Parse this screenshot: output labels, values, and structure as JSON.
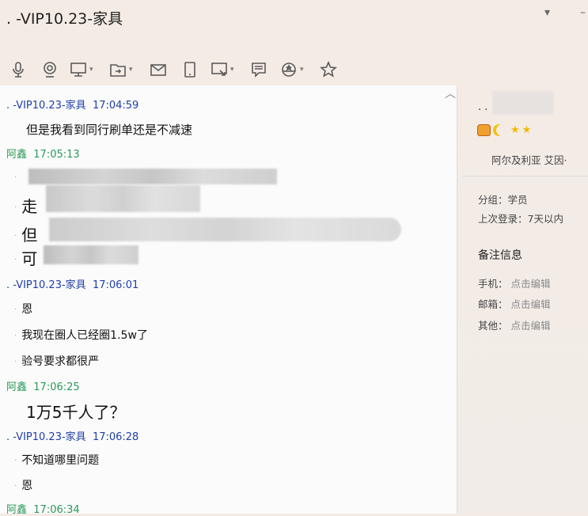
{
  "window": {
    "title": ". -VIP10.23-家具",
    "dropdown_icon": "▾",
    "minimize_icon": "–"
  },
  "toolbar": {
    "items": [
      "microphone-icon",
      "webcam-icon",
      "screen-share-icon",
      "file-transfer-icon",
      "mail-icon",
      "phone-icon",
      "remote-desktop-icon",
      "message-note-icon",
      "app-icon",
      "favorite-star-icon"
    ],
    "caret": "▾",
    "collapse": "︿"
  },
  "chat": [
    {
      "type": "header",
      "sender": ". -VIP10.23-家具",
      "time": "17:04:59",
      "color": "#1e3ea8"
    },
    {
      "type": "text",
      "text": "但是我看到同行刷单还是不减速"
    },
    {
      "type": "header",
      "sender": "阿鑫",
      "time": "17:05:13",
      "color": "#2a9a5a"
    },
    {
      "type": "bullet",
      "text": "·"
    },
    {
      "type": "bullet",
      "text": "走"
    },
    {
      "type": "bullet",
      "text": "但"
    },
    {
      "type": "bullet",
      "text": "可"
    },
    {
      "type": "header",
      "sender": ". -VIP10.23-家具",
      "time": "17:06:01"
    },
    {
      "type": "bullet",
      "text": "恩"
    },
    {
      "type": "bullet",
      "text": "我现在圈人已经圈1.5w了"
    },
    {
      "type": "bullet",
      "text": "验号要求都很严"
    },
    {
      "type": "header",
      "sender": "阿鑫",
      "time": "17:06:25"
    },
    {
      "type": "text",
      "text": "1万5千人了？"
    },
    {
      "type": "header",
      "sender": ". -VIP10.23-家具",
      "time": "17:06:28"
    },
    {
      "type": "bullet",
      "text": "不知道哪里问题"
    },
    {
      "type": "bullet",
      "text": "恩"
    },
    {
      "type": "header",
      "sender": "阿鑫",
      "time": "17:06:34"
    }
  ],
  "profile": {
    "name_prefix": ". .",
    "location": "阿尔及利亚 艾因·",
    "group_label": "分组：",
    "group": "学员",
    "last_login_label": "上次登录：",
    "last_login": "7天以内",
    "notes_title": "备注信息",
    "fields": [
      {
        "label": "手机：",
        "value": "点击编辑"
      },
      {
        "label": "邮箱：",
        "value": "点击编辑"
      },
      {
        "label": "其他：",
        "value": "点击编辑"
      }
    ]
  }
}
